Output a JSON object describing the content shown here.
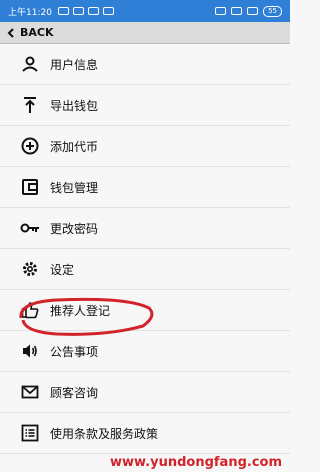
{
  "status_bar": {
    "time": "上午11:20",
    "battery": "55"
  },
  "header": {
    "back_label": "BACK"
  },
  "menu": [
    {
      "label": "用户信息",
      "icon": "person-icon"
    },
    {
      "label": "导出钱包",
      "icon": "upload-icon"
    },
    {
      "label": "添加代币",
      "icon": "add-circle-icon"
    },
    {
      "label": "钱包管理",
      "icon": "wallet-icon"
    },
    {
      "label": "更改密码",
      "icon": "key-icon"
    },
    {
      "label": "设定",
      "icon": "gear-icon"
    },
    {
      "label": "推荐人登记",
      "icon": "thumbs-up-icon"
    },
    {
      "label": "公告事项",
      "icon": "speaker-icon"
    },
    {
      "label": "顾客咨询",
      "icon": "mail-icon"
    },
    {
      "label": "使用条款及服务政策",
      "icon": "list-icon"
    }
  ],
  "watermark": "www.yundongfang.com",
  "colors": {
    "status_bar": "#2f7fd6",
    "annotation": "#d2232a"
  }
}
